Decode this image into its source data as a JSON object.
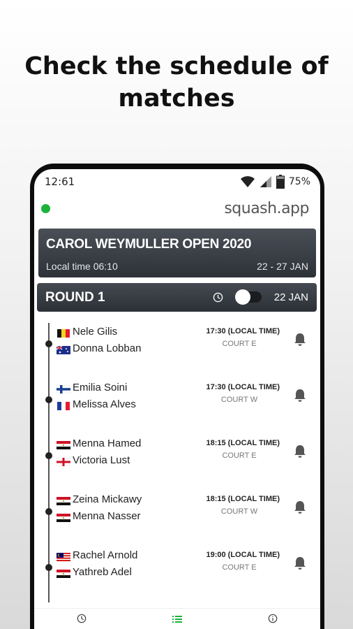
{
  "promo": {
    "headline_line1": "Check the schedule of",
    "headline_line2": "matches"
  },
  "statusbar": {
    "time": "12:61",
    "battery": "75%"
  },
  "app": {
    "title": "squash.app",
    "online": true
  },
  "tournament": {
    "name": "CAROL WEYMULLER OPEN 2020",
    "local_time": "Local time 06:10",
    "dates": "22 - 27 JAN"
  },
  "round": {
    "title": "ROUND 1",
    "date": "22 JAN",
    "toggle_on": true
  },
  "matches": [
    {
      "p1": {
        "name": "Nele Gilis",
        "flag": "belgium-flag"
      },
      "p2": {
        "name": "Donna Lobban",
        "flag": "australia-flag"
      },
      "time": "17:30 (LOCAL TIME)",
      "court": "COURT E"
    },
    {
      "p1": {
        "name": "Emilia Soini",
        "flag": "finland-flag"
      },
      "p2": {
        "name": "Melissa Alves",
        "flag": "france-flag"
      },
      "time": "17:30 (LOCAL TIME)",
      "court": "COURT W"
    },
    {
      "p1": {
        "name": "Menna Hamed",
        "flag": "egypt-flag"
      },
      "p2": {
        "name": "Victoria Lust",
        "flag": "england-flag"
      },
      "time": "18:15 (LOCAL TIME)",
      "court": "COURT E"
    },
    {
      "p1": {
        "name": "Zeina Mickawy",
        "flag": "egypt-flag"
      },
      "p2": {
        "name": "Menna Nasser",
        "flag": "egypt-flag"
      },
      "time": "18:15 (LOCAL TIME)",
      "court": "COURT W"
    },
    {
      "p1": {
        "name": "Rachel Arnold",
        "flag": "malaysia-flag"
      },
      "p2": {
        "name": "Yathreb Adel",
        "flag": "egypt-flag"
      },
      "time": "19:00 (LOCAL TIME)",
      "court": "COURT E"
    }
  ],
  "nav": {
    "items": [
      {
        "icon": "clock-icon",
        "label": ""
      },
      {
        "icon": "list-icon",
        "label": ""
      },
      {
        "icon": "info-icon",
        "label": ""
      }
    ],
    "active_color": "#1db33b"
  },
  "colors": {
    "accent": "#1db33b",
    "header_dark": "#2d3138"
  }
}
